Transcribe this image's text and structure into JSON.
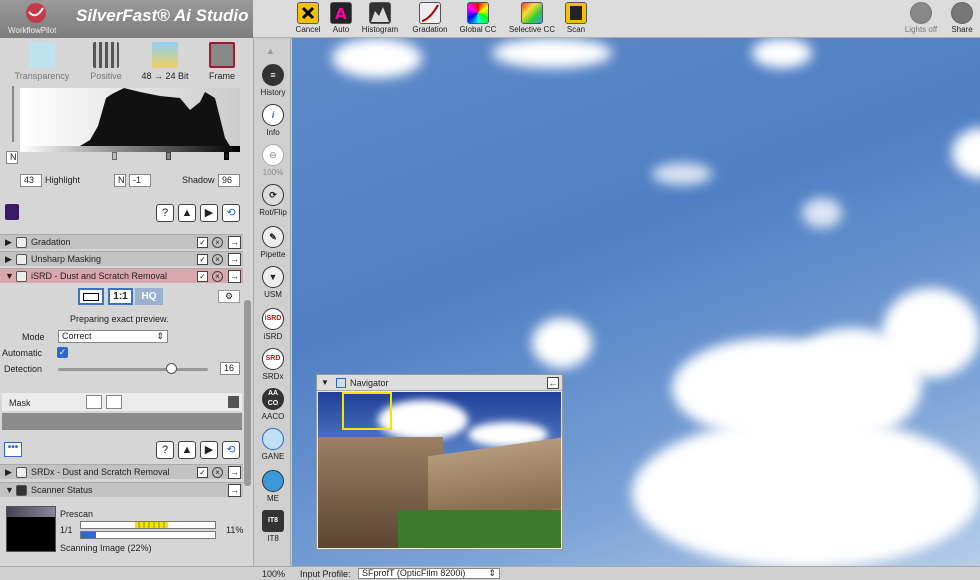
{
  "app": {
    "workflow_label": "WorkflowPilot",
    "title": "SilverFast® Ai Studio"
  },
  "toolbar": {
    "cancel": "Cancel",
    "auto": "Auto",
    "histogram": "Histogram",
    "gradation": "Gradation",
    "global_cc": "Global CC",
    "selective_cc": "Selective CC",
    "scan": "Scan",
    "lights_off": "Lights off",
    "share": "Share"
  },
  "modes": {
    "transparency": "Transparency",
    "positive": "Positive",
    "bit_depth": "48 → 24 Bit",
    "frame": "Frame"
  },
  "histogram": {
    "highlight_value": "43",
    "highlight_label": "Highlight",
    "n_label": "N",
    "n_value": "-1",
    "shadow_label": "Shadow",
    "shadow_value": "96"
  },
  "panels": {
    "gradation": "Gradation",
    "unsharp": "Unsharp Masking",
    "isrd": "iSRD - Dust and Scratch Removal",
    "srdx": "SRDx - Dust and Scratch Removal",
    "scanner_status": "Scanner Status"
  },
  "isrd": {
    "hq": "HQ",
    "one_to_one": "1:1",
    "preview_status": "Preparing exact preview.",
    "mode_label": "Mode",
    "mode_value": "Correct",
    "automatic_label": "Automatic",
    "detection_label": "Detection",
    "detection_value": "16",
    "detection_level": 0.75,
    "mask_label": "Mask"
  },
  "scanner": {
    "prescan": "Prescan",
    "count": "1/1",
    "percent": "11%",
    "status": "Scanning Image (22%)",
    "progress": 0.11
  },
  "tools": {
    "history": "History",
    "info": "Info",
    "zoom": "100%",
    "rotflip": "Rot/Flip",
    "pipette": "Pipette",
    "usm": "USM",
    "isrd": "iSRD",
    "srdx": "SRDx",
    "aaco": "AACO",
    "gane": "GANE",
    "me": "ME",
    "it8": "IT8",
    "aaco_icon": "AA CO",
    "it8_icon": "IT8"
  },
  "navigator": {
    "title": "Navigator"
  },
  "bottom": {
    "zoom": "100%",
    "input_profile_label": "Input Profile:",
    "input_profile_value": "SFprofT (OpticFilm 8200i)"
  },
  "colors": {
    "brand": "#8c8c8c",
    "panel_active": "#d9a7ae",
    "accent": "#3a73c4"
  }
}
